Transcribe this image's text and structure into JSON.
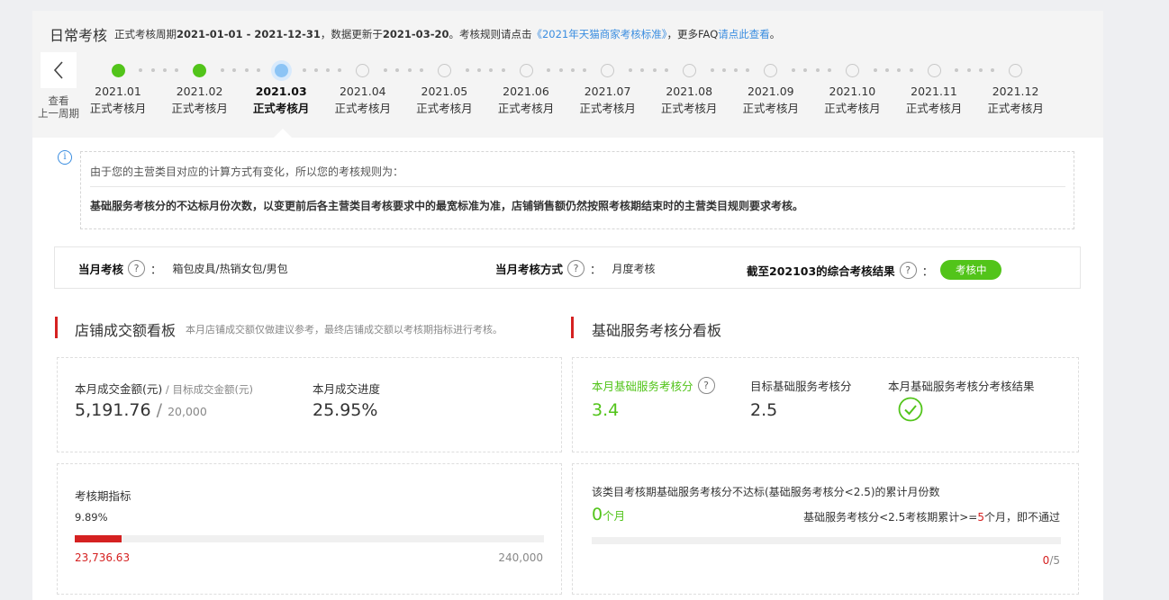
{
  "header": {
    "title": "日常考核",
    "period_prefix": "正式考核周期",
    "period": "2021-01-01 - 2021-12-31",
    "update_prefix": "，数据更新于",
    "update_date": "2021-03-20",
    "rule_prefix": "。考核规则请点击",
    "rule_link": "《2021年天猫商家考核标准》",
    "faq_prefix": "，更多FAQ",
    "faq_link": "请点此查看",
    "faq_suffix": "。"
  },
  "timeline": {
    "prev_label_1": "查看",
    "prev_label_2": "上一周期",
    "months": [
      {
        "month": "2021.01",
        "type": "正式考核月",
        "status": "done"
      },
      {
        "month": "2021.02",
        "type": "正式考核月",
        "status": "done"
      },
      {
        "month": "2021.03",
        "type": "正式考核月",
        "status": "current"
      },
      {
        "month": "2021.04",
        "type": "正式考核月",
        "status": "pending"
      },
      {
        "month": "2021.05",
        "type": "正式考核月",
        "status": "pending"
      },
      {
        "month": "2021.06",
        "type": "正式考核月",
        "status": "pending"
      },
      {
        "month": "2021.07",
        "type": "正式考核月",
        "status": "pending"
      },
      {
        "month": "2021.08",
        "type": "正式考核月",
        "status": "pending"
      },
      {
        "month": "2021.09",
        "type": "正式考核月",
        "status": "pending"
      },
      {
        "month": "2021.10",
        "type": "正式考核月",
        "status": "pending"
      },
      {
        "month": "2021.11",
        "type": "正式考核月",
        "status": "pending"
      },
      {
        "month": "2021.12",
        "type": "正式考核月",
        "status": "pending"
      }
    ]
  },
  "notice": {
    "icon": "info-icon",
    "line1": "由于您的主营类目对应的计算方式有变化，所以您的考核规则为：",
    "line2": "基础服务考核分的不达标月份次数，以变更前后各主营类目考核要求中的最宽标准为准，店铺销售额仍然按照考核期结束时的主营类目规则要求考核。"
  },
  "rules": {
    "month_label": "当月考核",
    "month_value": "箱包皮具/热销女包/男包",
    "method_label": "当月考核方式",
    "method_value": "月度考核",
    "result_label": "截至202103的综合考核结果",
    "result_badge": "考核中",
    "help_glyph": "?",
    "colon": "："
  },
  "sales": {
    "title": "店铺成交额看板",
    "note": "本月店铺成交额仅做建议参考，最终店铺成交额以考核期指标进行考核。",
    "amount_label": "本月成交金额(元)",
    "target_sep": " / ",
    "target_label": "目标成交金额(元)",
    "amount_value": "5,191.76",
    "target_value": "20,000",
    "progress_label": "本月成交进度",
    "progress_value": "25.95%",
    "period_label": "考核期指标",
    "period_pct": "9.89%",
    "period_fill_fraction": 0.0989,
    "period_current": "23,736.63",
    "period_target": "240,000"
  },
  "service": {
    "title": "基础服务考核分看板",
    "score_label": "本月基础服务考核分",
    "score_value": "3.4",
    "target_label": "目标基础服务考核分",
    "target_value": "2.5",
    "result_label": "本月基础服务考核分考核结果",
    "result_icon": "check-circle-icon",
    "fail_desc": "该类目考核期基础服务考核分不达标(基础服务考核分<2.5)的累计月份数",
    "fail_count": "0",
    "fail_unit": "个月",
    "fail_rule_prefix": "基础服务考核分<2.5考核期累计>=",
    "fail_rule_num": "5",
    "fail_rule_suffix": "个月，即不通过",
    "fail_ratio_num": "0",
    "fail_ratio_den": "/5",
    "fail_fill_fraction": 0
  },
  "colors": {
    "accent_red": "#d52121",
    "green": "#52c41a",
    "link_blue": "#3a8de0",
    "current_blue": "#8cc4f5"
  }
}
